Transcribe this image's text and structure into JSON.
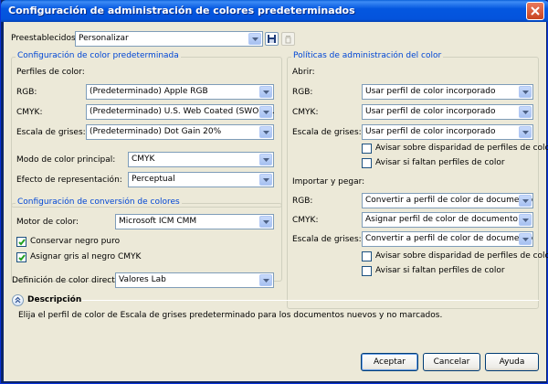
{
  "window": {
    "title": "Configuración de administración de colores predeterminados"
  },
  "presets": {
    "label": "Preestablecidos:",
    "value": "Personalizar"
  },
  "default_group": {
    "title": "Configuración de color predeterminada",
    "profiles_label": "Perfiles de color:",
    "rgb_label": "RGB:",
    "rgb_value": "(Predeterminado) Apple RGB",
    "cmyk_label": "CMYK:",
    "cmyk_value": "(Predeterminado) U.S. Web Coated (SWOP)...",
    "gray_label": "Escala de grises:",
    "gray_value": "(Predeterminado) Dot Gain 20%",
    "mode_label": "Modo de color principal:",
    "mode_value": "CMYK",
    "intent_label": "Efecto de representación:",
    "intent_value": "Perceptual"
  },
  "conversion_group": {
    "title": "Configuración de conversión de colores",
    "engine_label": "Motor de color:",
    "engine_value": "Microsoft ICM CMM",
    "preserve_black_label": "Conservar negro puro",
    "preserve_black_checked": true,
    "map_gray_label": "Asignar gris al negro CMYK",
    "map_gray_checked": true
  },
  "spot": {
    "label": "Definición de color directo:",
    "value": "Valores Lab"
  },
  "policies_group": {
    "title": "Políticas de administración del color",
    "open_label": "Abrir:",
    "open_rgb_label": "RGB:",
    "open_rgb_value": "Usar perfil de color incorporado",
    "open_cmyk_label": "CMYK:",
    "open_cmyk_value": "Usar perfil de color incorporado",
    "open_gray_label": "Escala de grises:",
    "open_gray_value": "Usar perfil de color incorporado",
    "open_warn_mismatch_label": "Avisar sobre disparidad de perfiles de color",
    "open_warn_missing_label": "Avisar si faltan perfiles de color",
    "import_label": "Importar y pegar:",
    "import_rgb_label": "RGB:",
    "import_rgb_value": "Convertir a perfil de color de documento",
    "import_cmyk_label": "CMYK:",
    "import_cmyk_value": "Asignar perfil de color de documento",
    "import_gray_label": "Escala de grises:",
    "import_gray_value": "Convertir a perfil de color de documento",
    "import_warn_mismatch_label": "Avisar sobre disparidad de perfiles de color",
    "import_warn_missing_label": "Avisar si faltan perfiles de color"
  },
  "description": {
    "heading": "Descripción",
    "text": "Elija el perfil de color de Escala de grises predeterminado para los documentos nuevos y no marcados."
  },
  "buttons": {
    "ok": "Aceptar",
    "cancel": "Cancelar",
    "help": "Ayuda"
  },
  "icons": {
    "close": "close-icon",
    "save": "save-icon",
    "delete": "trash-icon",
    "dropdown": "chevron-down-icon",
    "collapse": "double-chevron-up-icon"
  },
  "colors": {
    "title_bar": "#0453dc",
    "group_title": "#0046d5",
    "face": "#ece9d8",
    "close_button": "#c8441f"
  }
}
